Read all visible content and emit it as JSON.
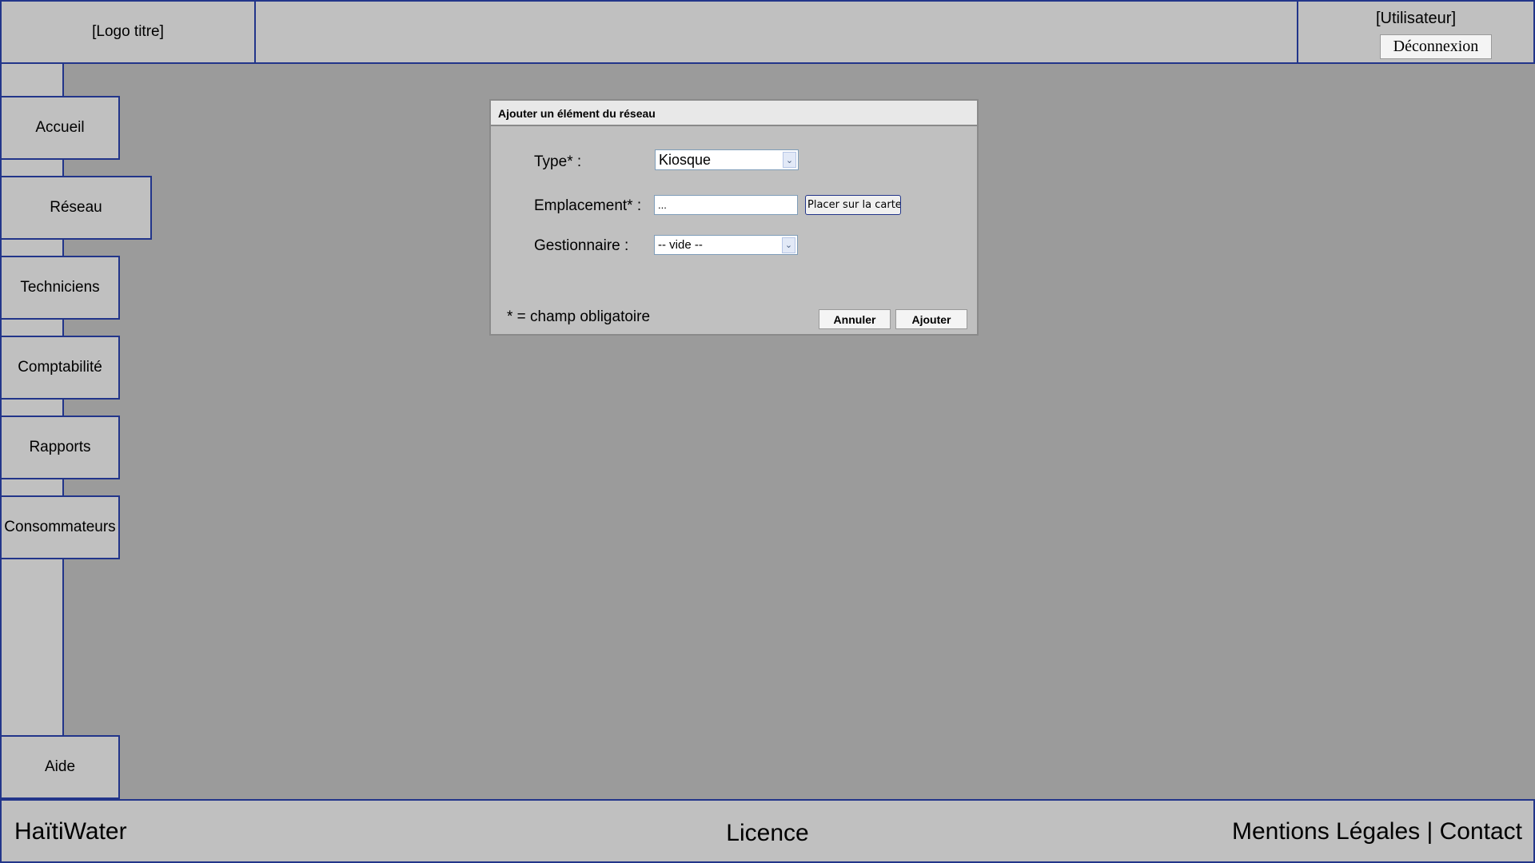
{
  "header": {
    "logo_text": "[Logo titre]",
    "user_label": "[Utilisateur]",
    "logout_label": "Déconnexion"
  },
  "sidebar": {
    "items": [
      {
        "label": "Accueil"
      },
      {
        "label": "Réseau"
      },
      {
        "label": "Techniciens"
      },
      {
        "label": "Comptabilité"
      },
      {
        "label": "Rapports"
      },
      {
        "label": "Consommateurs"
      }
    ],
    "help_label": "Aide"
  },
  "dialog": {
    "title": "Ajouter un élément du réseau",
    "type_label": "Type* :",
    "type_value": "Kiosque",
    "location_label": "Emplacement* :",
    "location_value": "...",
    "place_on_map_label": "Placer sur la carte",
    "manager_label": "Gestionnaire :",
    "manager_value": "-- vide --",
    "required_note": "* = champ obligatoire",
    "cancel_label": "Annuler",
    "add_label": "Ajouter"
  },
  "footer": {
    "brand": "HaïtiWater",
    "licence": "Licence",
    "legal": "Mentions Légales",
    "separator": " | ",
    "contact": "Contact"
  },
  "colors": {
    "background": "#9b9b9b",
    "panel": "#c0c0c0",
    "border_accent": "#22358a"
  }
}
